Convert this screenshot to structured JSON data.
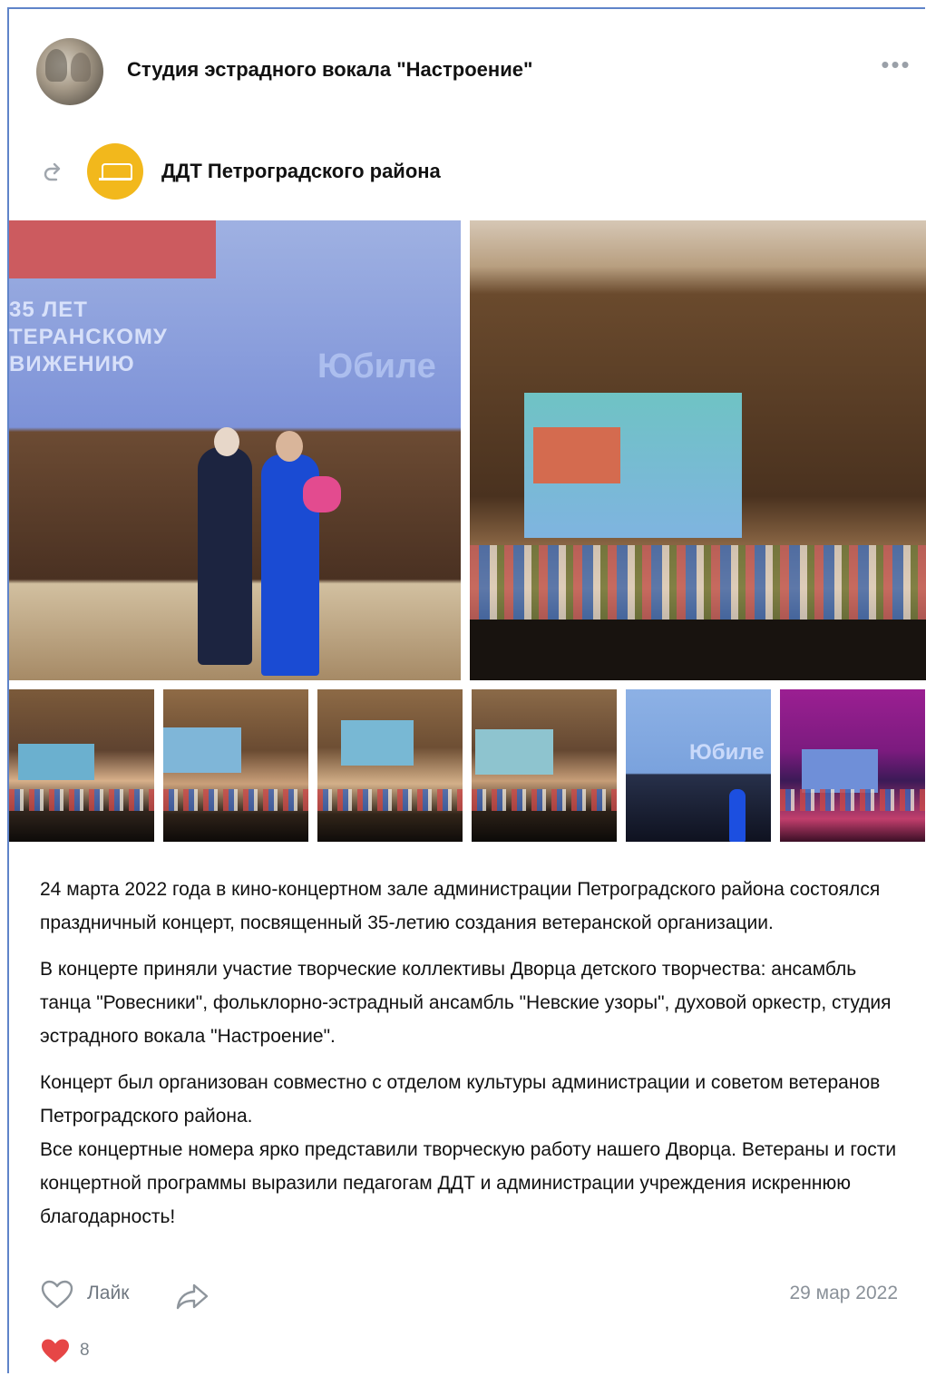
{
  "post": {
    "group_name": "Студия эстрадного вокала \"Настроение\"",
    "more_icon": "more-horizontal-icon",
    "repost": {
      "icon": "repost-icon",
      "source_name": "ДДТ Петроградского района"
    },
    "photos": {
      "big1_text": "35 ЛЕТ\nТЕРАНСКОМУ\nВИЖЕНИЮ",
      "big1_yubilei": "Юбиле",
      "thumb5_yubilei": "Юбиле"
    },
    "text": {
      "p1": "24 марта 2022 года в кино-концертном зале администрации Петроградского района состоялся праздничный концерт, посвященный 35-летию создания ветеранской организации.",
      "p2": "В концерте приняли участие творческие коллективы Дворца детского творчества: ансамбль танца \"Ровесники\", фольклорно-эстрадный ансамбль \"Невские узоры\", духовой оркестр, студия эстрадного вокала \"Настроение\".",
      "p3a": "Концерт был организован совместно с отделом культуры администрации и советом ветеранов Петроградского района.",
      "p3b": "Все концертные номера ярко представили творческую работу нашего Дворца. Ветераны и гости концертной программы выразили педагогам ДДТ и администрации учреждения искреннюю благодарность!"
    },
    "actions": {
      "like_label": "Лайк",
      "like_icon": "heart-outline-icon",
      "share_icon": "share-icon",
      "date": "29 мар 2022"
    },
    "reactions": {
      "icon": "heart-filled-icon",
      "count": "8",
      "color": "#e64646"
    }
  }
}
